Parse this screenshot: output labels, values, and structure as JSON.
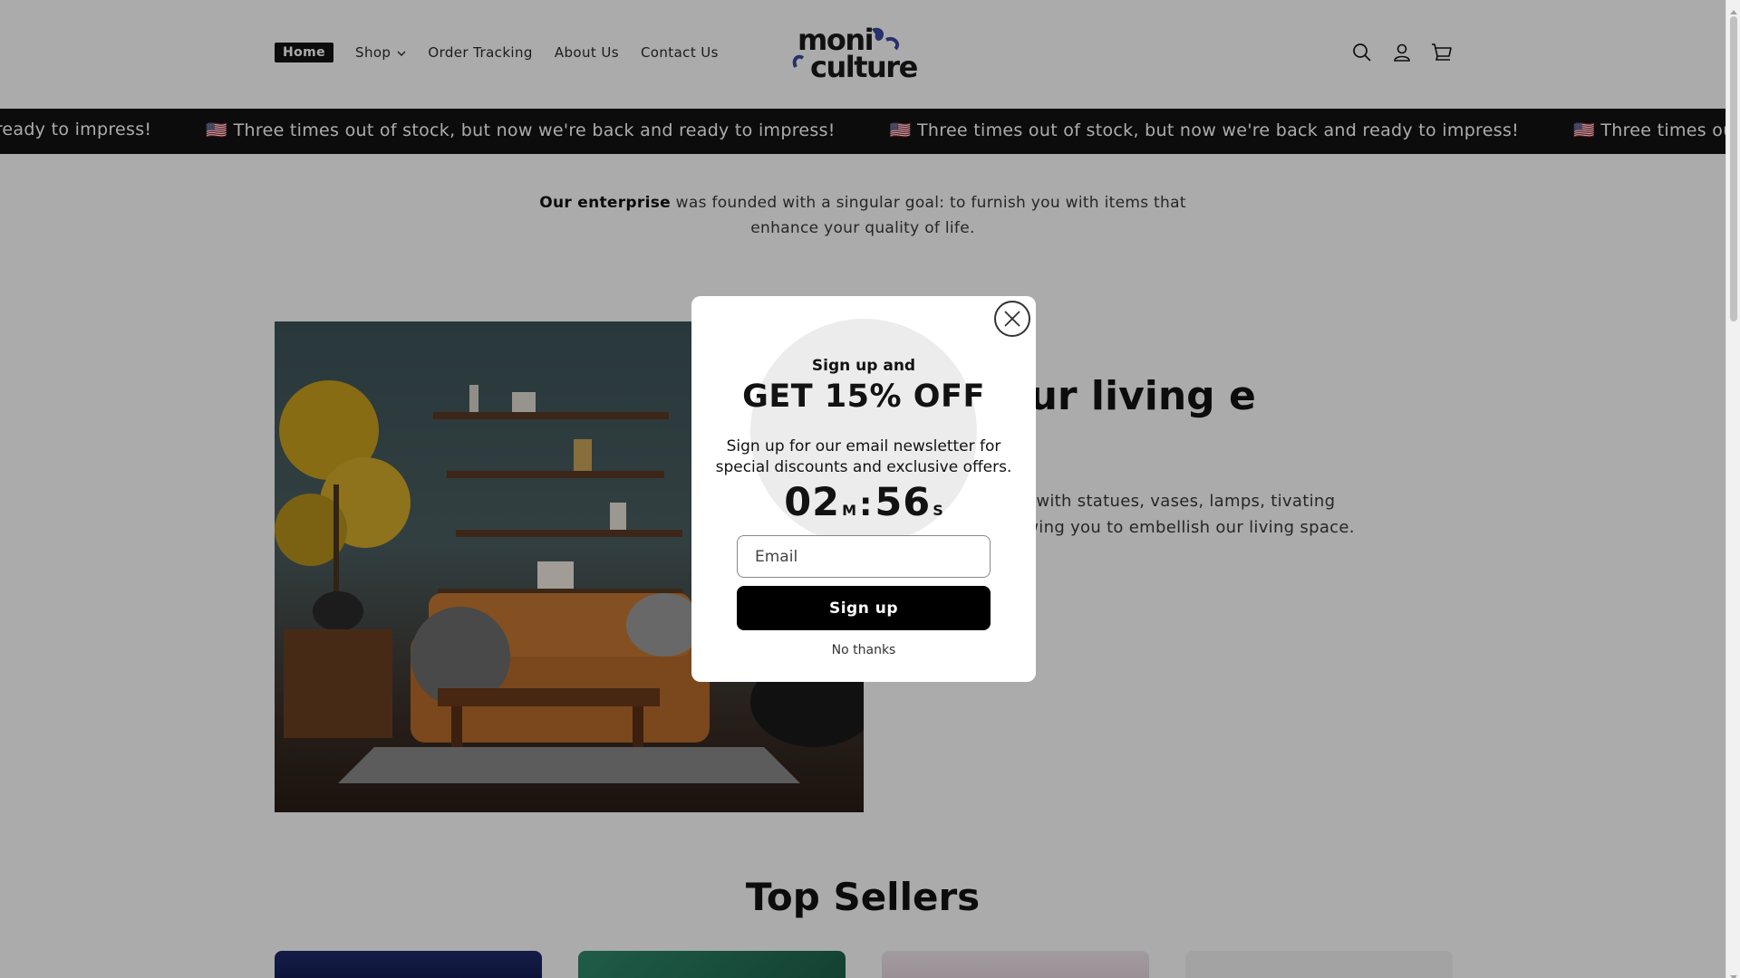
{
  "header": {
    "nav": {
      "home": "Home",
      "shop": "Shop",
      "order_tracking": "Order Tracking",
      "about_us": "About Us",
      "contact_us": "Contact Us"
    },
    "logo": {
      "line1": "moni",
      "line2": "culture"
    },
    "icons": [
      "search-icon",
      "account-icon",
      "cart-icon"
    ]
  },
  "announcement": {
    "items": [
      "d ready to impress!",
      "🇺🇸 Three times out of stock, but now we're back and ready to impress!",
      "🇺🇸 Three times out of stock, but now we're back and ready to impress!",
      "🇺🇸 Three times out of stoc"
    ]
  },
  "intro": {
    "bold": "Our enterprise",
    "rest": " was founded with a singular goal: to furnish you with items that enhance your quality of life."
  },
  "feature": {
    "title": "ge your living e",
    "description": "ome ambiance with statues, vases, lamps, tivating elements, allowing you to embellish our living space."
  },
  "top_sellers": {
    "title": "Top Sellers"
  },
  "popup": {
    "pre_title": "Sign up and",
    "title": "GET 15% OFF",
    "description": "Sign up for our email newsletter for special discounts and exclusive offers.",
    "timer": {
      "minutes": "02",
      "minutes_unit": "M",
      "separator": ":",
      "seconds": "56",
      "seconds_unit": "S"
    },
    "email_placeholder": "Email",
    "signup_label": "Sign up",
    "no_thanks_label": "No thanks"
  },
  "colors": {
    "accent": "#121212",
    "announcement_bg": "#121212",
    "overlay": "rgba(0,0,0,0.33)",
    "logo_accent": "#3b4a9e"
  }
}
